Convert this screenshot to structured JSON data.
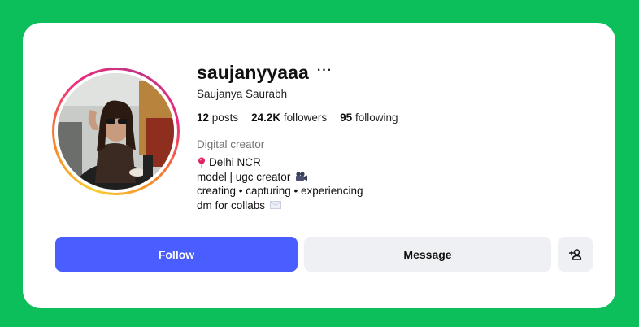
{
  "profile": {
    "username": "saujanyyaaa",
    "more_label": "···",
    "full_name": "Saujanya Saurabh",
    "stats": {
      "posts_count": "12",
      "posts_label": "posts",
      "followers_count": "24.2K",
      "followers_label": "followers",
      "following_count": "95",
      "following_label": "following"
    },
    "category": "Digital creator",
    "bio": {
      "line1": "Delhi NCR",
      "line2": "model | ugc creator",
      "line3": "creating • capturing • experiencing",
      "line4": "dm for collabs"
    },
    "icons": {
      "more": "more-options-icon",
      "pin": "round-pushpin-icon",
      "camera": "movie-camera-icon",
      "mail": "envelope-icon",
      "add_user": "add-user-icon"
    }
  },
  "actions": {
    "follow_label": "Follow",
    "message_label": "Message"
  },
  "colors": {
    "page_background": "#0cbf5a",
    "card_background": "#ffffff",
    "follow_button": "#4a5dff",
    "secondary_button": "#eff0f3",
    "muted_text": "#737373"
  }
}
